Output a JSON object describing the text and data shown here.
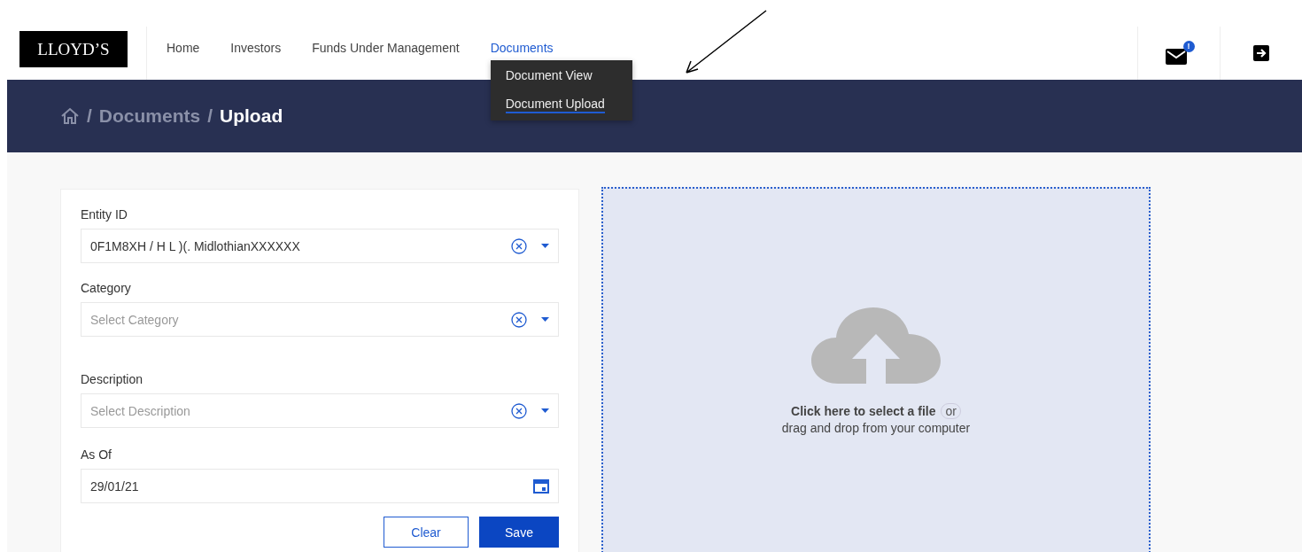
{
  "logo": "LLOYD’S",
  "nav": [
    {
      "label": "Home",
      "selected": false
    },
    {
      "label": "Investors",
      "selected": false
    },
    {
      "label": "Funds Under Management",
      "selected": false
    },
    {
      "label": "Documents",
      "selected": true
    }
  ],
  "dropdown": [
    {
      "label": "Document View",
      "selected": false
    },
    {
      "label": "Document Upload",
      "selected": true
    }
  ],
  "notifications": {
    "badge": "!"
  },
  "breadcrumb": {
    "separator": "/",
    "items": [
      {
        "label": "Documents",
        "current": false
      },
      {
        "label": "Upload",
        "current": true
      }
    ]
  },
  "form": {
    "fields": [
      {
        "kind": "select",
        "label": "Entity ID",
        "value": "0F1M8XH / H L )(. MidlothianXXXXXX"
      },
      {
        "kind": "select",
        "label": "Category",
        "placeholder": "Select Category"
      },
      {
        "kind": "select",
        "label": "Description",
        "placeholder": "Select Description"
      },
      {
        "kind": "date",
        "label": "As Of",
        "value": "29/01/21"
      }
    ],
    "buttons": [
      {
        "label": "Clear",
        "kind": "secondary"
      },
      {
        "label": "Save",
        "kind": "primary"
      }
    ]
  },
  "dropzone": {
    "action": "Click here to select a file",
    "or": "or",
    "hint": "drag and drop from your computer"
  }
}
